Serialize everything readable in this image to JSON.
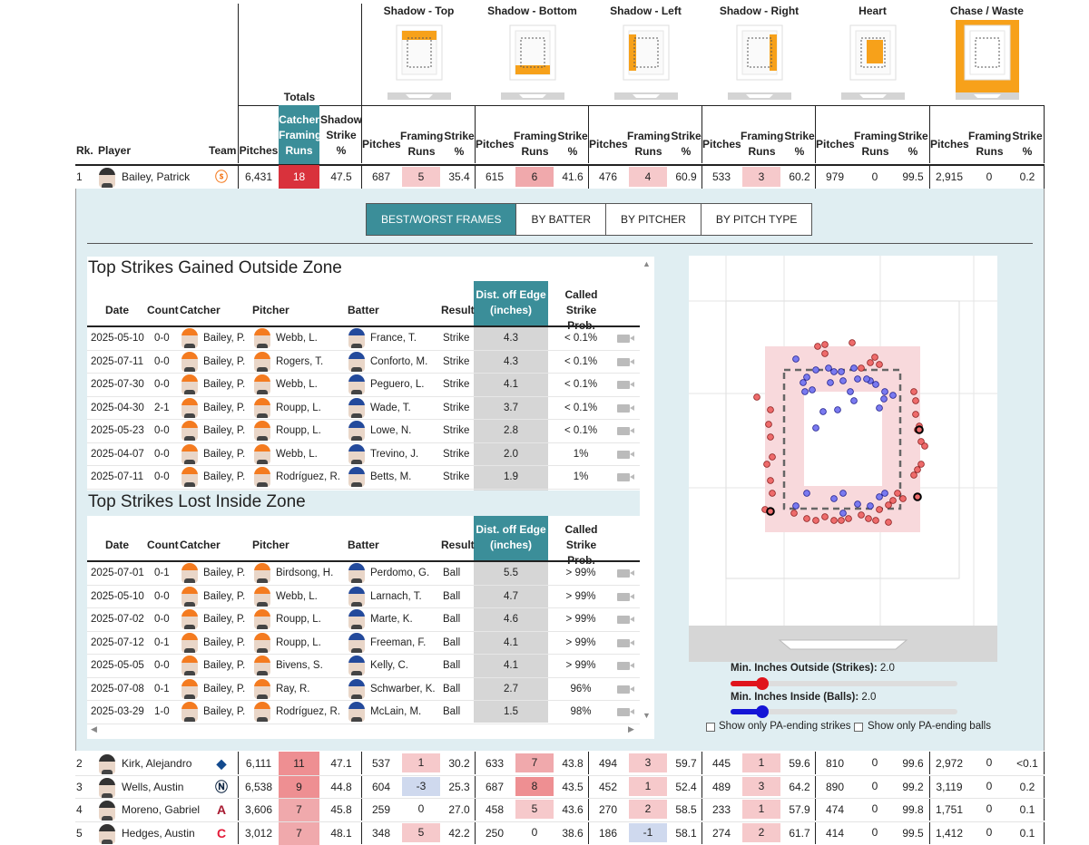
{
  "zones": [
    {
      "label": "Shadow - Top"
    },
    {
      "label": "Shadow - Bottom"
    },
    {
      "label": "Shadow - Left"
    },
    {
      "label": "Shadow - Right"
    },
    {
      "label": "Heart"
    },
    {
      "label": "Chase / Waste"
    }
  ],
  "header": {
    "totals": "Totals",
    "rk": "Rk.",
    "player": "Player",
    "team": "Team",
    "pitches": "Pitches",
    "catcher_framing_runs": "Catcher Framing Runs",
    "shadow_strike_pct": "Shadow Strike %",
    "zone_pitches": "Pitches",
    "zone_runs": "Framing Runs",
    "zone_strike": "Strike %"
  },
  "colors": {
    "teal": "#3b8e99",
    "red_dark": "#d9323c",
    "red_mid": "#ee8f92",
    "red_light": "#f6c9cb",
    "blue_light": "#cfd9ee",
    "orange": "#f7a11a"
  },
  "top_row": {
    "rk": "1",
    "name": "Bailey, Patrick",
    "team_icon": "sf-giants-logo",
    "pitches": "6,431",
    "runs": "18",
    "shadow": "47.5",
    "zones": [
      [
        "687",
        "5",
        "35.4"
      ],
      [
        "615",
        "6",
        "41.6"
      ],
      [
        "476",
        "4",
        "60.9"
      ],
      [
        "533",
        "3",
        "60.2"
      ],
      [
        "979",
        "0",
        "99.5"
      ],
      [
        "2,915",
        "0",
        "0.2"
      ]
    ]
  },
  "tabs": [
    "BEST/WORST FRAMES",
    "BY BATTER",
    "BY PITCHER",
    "BY PITCH TYPE"
  ],
  "gained": {
    "title": "Top Strikes Gained Outside Zone",
    "headers": {
      "date": "Date",
      "count": "Count",
      "catcher": "Catcher",
      "pitcher": "Pitcher",
      "batter": "Batter",
      "result": "Result",
      "dist": "Dist. off Edge (inches)",
      "prob": "Called Strike Prob."
    },
    "rows": [
      {
        "date": "2025-05-10",
        "count": "0-0",
        "catcher": "Bailey, P.",
        "pitcher": "Webb, L.",
        "batter": "France, T.",
        "result": "Strike",
        "dist": "4.3",
        "prob": "< 0.1%"
      },
      {
        "date": "2025-07-11",
        "count": "0-0",
        "catcher": "Bailey, P.",
        "pitcher": "Rogers, T.",
        "batter": "Conforto, M.",
        "result": "Strike",
        "dist": "4.3",
        "prob": "< 0.1%"
      },
      {
        "date": "2025-07-30",
        "count": "0-0",
        "catcher": "Bailey, P.",
        "pitcher": "Webb, L.",
        "batter": "Peguero, L.",
        "result": "Strike",
        "dist": "4.1",
        "prob": "< 0.1%"
      },
      {
        "date": "2025-04-30",
        "count": "2-1",
        "catcher": "Bailey, P.",
        "pitcher": "Roupp, L.",
        "batter": "Wade, T.",
        "result": "Strike",
        "dist": "3.7",
        "prob": "< 0.1%"
      },
      {
        "date": "2025-05-23",
        "count": "0-0",
        "catcher": "Bailey, P.",
        "pitcher": "Roupp, L.",
        "batter": "Lowe, N.",
        "result": "Strike",
        "dist": "2.8",
        "prob": "< 0.1%"
      },
      {
        "date": "2025-04-07",
        "count": "0-0",
        "catcher": "Bailey, P.",
        "pitcher": "Webb, L.",
        "batter": "Trevino, J.",
        "result": "Strike",
        "dist": "2.0",
        "prob": "1%"
      },
      {
        "date": "2025-07-11",
        "count": "0-0",
        "catcher": "Bailey, P.",
        "pitcher": "Rodríguez, R.",
        "batter": "Betts, M.",
        "result": "Strike",
        "dist": "1.9",
        "prob": "1%"
      }
    ]
  },
  "lost": {
    "title": "Top Strikes Lost Inside Zone",
    "headers": {
      "date": "Date",
      "count": "Count",
      "catcher": "Catcher",
      "pitcher": "Pitcher",
      "batter": "Batter",
      "result": "Result",
      "dist": "Dist. off Edge (inches)",
      "prob": "Called Strike Prob."
    },
    "rows": [
      {
        "date": "2025-07-01",
        "count": "0-1",
        "catcher": "Bailey, P.",
        "pitcher": "Birdsong, H.",
        "batter": "Perdomo, G.",
        "result": "Ball",
        "dist": "5.5",
        "prob": "> 99%"
      },
      {
        "date": "2025-05-10",
        "count": "0-0",
        "catcher": "Bailey, P.",
        "pitcher": "Webb, L.",
        "batter": "Larnach, T.",
        "result": "Ball",
        "dist": "4.7",
        "prob": "> 99%"
      },
      {
        "date": "2025-07-02",
        "count": "0-0",
        "catcher": "Bailey, P.",
        "pitcher": "Roupp, L.",
        "batter": "Marte, K.",
        "result": "Ball",
        "dist": "4.6",
        "prob": "> 99%"
      },
      {
        "date": "2025-07-12",
        "count": "0-1",
        "catcher": "Bailey, P.",
        "pitcher": "Roupp, L.",
        "batter": "Freeman, F.",
        "result": "Ball",
        "dist": "4.1",
        "prob": "> 99%"
      },
      {
        "date": "2025-05-05",
        "count": "0-0",
        "catcher": "Bailey, P.",
        "pitcher": "Bivens, S.",
        "batter": "Kelly, C.",
        "result": "Ball",
        "dist": "4.1",
        "prob": "> 99%"
      },
      {
        "date": "2025-07-08",
        "count": "0-1",
        "catcher": "Bailey, P.",
        "pitcher": "Ray, R.",
        "batter": "Schwarber, K.",
        "result": "Ball",
        "dist": "2.7",
        "prob": "96%"
      },
      {
        "date": "2025-03-29",
        "count": "1-0",
        "catcher": "Bailey, P.",
        "pitcher": "Rodríguez, R.",
        "batter": "McLain, M.",
        "result": "Ball",
        "dist": "1.5",
        "prob": "98%"
      }
    ]
  },
  "controls": {
    "outside_label": "Min. Inches Outside (Strikes):",
    "outside_value": "2.0",
    "outside_fraction": 0.2,
    "inside_label": "Min. Inches Inside (Balls):",
    "inside_value": "2.0",
    "inside_fraction": 0.2,
    "chk_strikes": "Show only PA-ending strikes",
    "chk_balls": "Show only PA-ending balls"
  },
  "bottom_rows": [
    {
      "rk": "2",
      "name": "Kirk, Alejandro",
      "team_icon": "blue-jays-logo",
      "pitches": "6,111",
      "runs": "11",
      "shadow": "47.1",
      "zones": [
        [
          "537",
          "1",
          "30.2"
        ],
        [
          "633",
          "7",
          "43.8"
        ],
        [
          "494",
          "3",
          "59.7"
        ],
        [
          "445",
          "1",
          "59.6"
        ],
        [
          "810",
          "0",
          "99.6"
        ],
        [
          "2,972",
          "0",
          "<0.1"
        ]
      ]
    },
    {
      "rk": "3",
      "name": "Wells, Austin",
      "team_icon": "yankees-logo",
      "pitches": "6,538",
      "runs": "9",
      "shadow": "44.8",
      "zones": [
        [
          "604",
          "-3",
          "25.3"
        ],
        [
          "687",
          "8",
          "43.5"
        ],
        [
          "452",
          "1",
          "52.4"
        ],
        [
          "489",
          "3",
          "64.2"
        ],
        [
          "890",
          "0",
          "99.2"
        ],
        [
          "3,119",
          "0",
          "0.2"
        ]
      ]
    },
    {
      "rk": "4",
      "name": "Moreno, Gabriel",
      "team_icon": "diamondbacks-logo",
      "pitches": "3,606",
      "runs": "7",
      "shadow": "45.8",
      "zones": [
        [
          "259",
          "0",
          "27.0"
        ],
        [
          "458",
          "5",
          "43.6"
        ],
        [
          "270",
          "2",
          "58.5"
        ],
        [
          "233",
          "1",
          "57.9"
        ],
        [
          "474",
          "0",
          "99.8"
        ],
        [
          "1,751",
          "0",
          "0.1"
        ]
      ]
    },
    {
      "rk": "5",
      "name": "Hedges, Austin",
      "team_icon": "guardians-logo",
      "pitches": "3,012",
      "runs": "7",
      "shadow": "48.1",
      "zones": [
        [
          "348",
          "5",
          "42.2"
        ],
        [
          "250",
          "0",
          "38.6"
        ],
        [
          "186",
          "-1",
          "58.1"
        ],
        [
          "274",
          "2",
          "61.7"
        ],
        [
          "414",
          "0",
          "99.5"
        ],
        [
          "1,412",
          "0",
          "0.1"
        ]
      ]
    }
  ]
}
